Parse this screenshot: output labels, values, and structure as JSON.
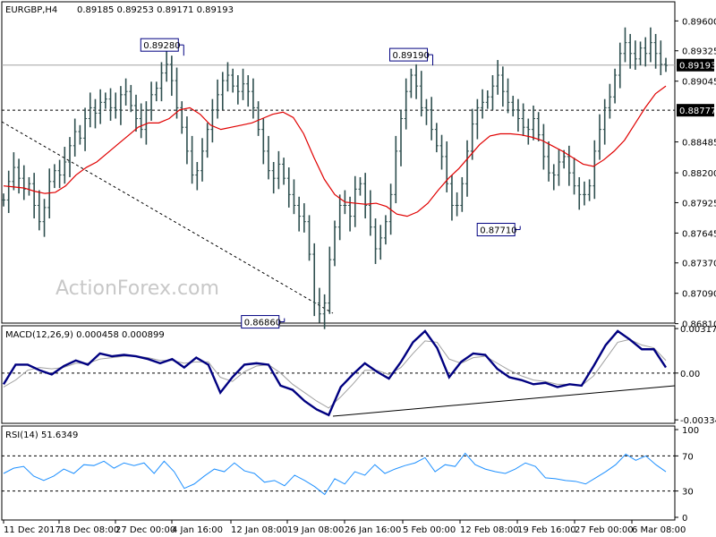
{
  "header": {
    "symbol": "EURGBP,H4",
    "ohlc": "0.89185 0.89253 0.89171 0.89193"
  },
  "watermark": "ActionForex.com",
  "colors": {
    "candles": "#2f4f4f",
    "ma": "#e00000",
    "macd": "#000080",
    "signal": "#a0a0a0",
    "rsi": "#1e90ff",
    "price_tag_bg": "#000000",
    "annotation_border": "#000080"
  },
  "chart_data": [
    {
      "type": "line",
      "title": "EURGBP,H4",
      "ylim": [
        0.8684,
        0.8976
      ],
      "yticks": [
        "0.89600",
        "0.89325",
        "0.89045",
        "0.88485",
        "0.88200",
        "0.87925",
        "0.87645",
        "0.87370",
        "0.87090",
        "0.86810"
      ],
      "xticks": [
        "11 Dec 2017",
        "18 Dec 08:00",
        "27 Dec 00:00",
        "4 Jan 16:00",
        "12 Jan 08:00",
        "19 Jan 08:00",
        "26 Jan 16:00",
        "5 Feb 00:00",
        "12 Feb 08:00",
        "19 Feb 16:00",
        "27 Feb 00:00",
        "6 Mar 08:00"
      ],
      "current_price": "0.89193",
      "horizontal_level": "0.88777",
      "annotations": [
        {
          "text": "0.89280",
          "value": 0.8928
        },
        {
          "text": "0.89190",
          "value": 0.8919
        },
        {
          "text": "0.87710",
          "value": 0.8771
        },
        {
          "text": "0.86860",
          "value": 0.8686
        }
      ],
      "series": [
        {
          "values": [
            0.8795,
            0.8812,
            0.8825,
            0.8815,
            0.8805,
            0.881,
            0.879,
            0.8775,
            0.8788,
            0.8812,
            0.8822,
            0.8818,
            0.883,
            0.8845,
            0.8858,
            0.8852,
            0.887,
            0.888,
            0.8875,
            0.8885,
            0.8888,
            0.888,
            0.8878,
            0.8892,
            0.8895,
            0.8882,
            0.887,
            0.886,
            0.8878,
            0.8892,
            0.8898,
            0.8912,
            0.892,
            0.8905,
            0.888,
            0.8862,
            0.884,
            0.8818,
            0.8822,
            0.884,
            0.886,
            0.8878,
            0.8892,
            0.8905,
            0.891,
            0.89,
            0.8895,
            0.8902,
            0.8895,
            0.888,
            0.886,
            0.884,
            0.8822,
            0.8815,
            0.8828,
            0.8815,
            0.88,
            0.879,
            0.878,
            0.8775,
            0.8745,
            0.87,
            0.869,
            0.87,
            0.874,
            0.877,
            0.879,
            0.879,
            0.878,
            0.8805,
            0.881,
            0.879,
            0.877,
            0.875,
            0.876,
            0.8775,
            0.88,
            0.884,
            0.887,
            0.8895,
            0.891,
            0.89,
            0.888,
            0.8878,
            0.886,
            0.8845,
            0.8835,
            0.881,
            0.879,
            0.879,
            0.881,
            0.884,
            0.8865,
            0.888,
            0.8885,
            0.889,
            0.89,
            0.891,
            0.8895,
            0.8885,
            0.8878,
            0.887,
            0.8862,
            0.886,
            0.887,
            0.8855,
            0.8835,
            0.882,
            0.8818,
            0.883,
            0.8835,
            0.882,
            0.8808,
            0.88,
            0.88,
            0.8808,
            0.884,
            0.886,
            0.888,
            0.889,
            0.891,
            0.893,
            0.894,
            0.893,
            0.8925,
            0.8935,
            0.893,
            0.894,
            0.893,
            0.892,
            0.8919
          ]
        },
        {
          "name": "MA",
          "values": [
            0.8808,
            0.8807,
            0.8806,
            0.8803,
            0.8801,
            0.8802,
            0.8808,
            0.8818,
            0.8825,
            0.883,
            0.8838,
            0.8846,
            0.8854,
            0.8862,
            0.8866,
            0.8866,
            0.887,
            0.8878,
            0.888,
            0.8874,
            0.8864,
            0.886,
            0.8862,
            0.8864,
            0.8866,
            0.887,
            0.8874,
            0.8876,
            0.8871,
            0.8856,
            0.8834,
            0.8814,
            0.88,
            0.8793,
            0.8792,
            0.8791,
            0.8792,
            0.8789,
            0.8782,
            0.878,
            0.8784,
            0.8792,
            0.8804,
            0.8815,
            0.8824,
            0.8835,
            0.8846,
            0.8854,
            0.8856,
            0.8856,
            0.8855,
            0.8853,
            0.885,
            0.8845,
            0.884,
            0.8834,
            0.8828,
            0.8826,
            0.8832,
            0.884,
            0.885,
            0.8865,
            0.888,
            0.8893,
            0.89
          ]
        }
      ]
    },
    {
      "type": "line",
      "title": "MACD(12,26,9) 0.000458 0.000899",
      "ylim": [
        -0.0034,
        0.00325
      ],
      "yticks": [
        "0.003177",
        "0.00",
        "-0.003344"
      ],
      "series": [
        {
          "name": "MACD",
          "values": [
            -0.0008,
            0.0006,
            0.0006,
            0.0002,
            -0.0001,
            0.0005,
            0.0009,
            0.0006,
            0.0014,
            0.0012,
            0.0013,
            0.0012,
            0.001,
            0.0007,
            0.001,
            0.0004,
            0.0011,
            0.0006,
            -0.0014,
            -0.0003,
            0.0006,
            0.0007,
            0.0006,
            -0.0009,
            -0.0012,
            -0.002,
            -0.0026,
            -0.003,
            -0.001,
            -0.0001,
            0.0007,
            0.0001,
            -0.0004,
            0.0008,
            0.0022,
            0.003,
            0.0018,
            -0.0003,
            0.0008,
            0.0014,
            0.0013,
            0.0003,
            -0.0003,
            -0.0005,
            -0.0008,
            -0.0007,
            -0.001,
            -0.0008,
            -0.0009,
            0.0005,
            0.002,
            0.003,
            0.0024,
            0.0017,
            0.0017,
            0.0004
          ]
        },
        {
          "name": "Signal",
          "values": [
            -0.001,
            -0.0005,
            0.0002,
            0.0004,
            0.0003,
            0.0004,
            0.0007,
            0.0007,
            0.001,
            0.0011,
            0.0012,
            0.0012,
            0.0011,
            0.0009,
            0.0009,
            0.0007,
            0.0008,
            0.0008,
            -0.0003,
            -0.0006,
            0.0001,
            0.0005,
            0.0006,
            0.0,
            -0.0008,
            -0.0014,
            -0.002,
            -0.0025,
            -0.0017,
            -0.0008,
            0.0002,
            0.0002,
            -0.0001,
            0.0004,
            0.0014,
            0.0023,
            0.0022,
            0.001,
            0.0007,
            0.0011,
            0.0012,
            0.0007,
            0.0002,
            -0.0002,
            -0.0005,
            -0.0006,
            -0.0008,
            -0.0008,
            -0.0009,
            -0.0002,
            0.001,
            0.0022,
            0.0024,
            0.002,
            0.0018,
            0.0009
          ]
        }
      ]
    },
    {
      "type": "line",
      "title": "RSI(14) 51.6349",
      "ylim": [
        0,
        100
      ],
      "yticks": [
        "100",
        "70",
        "30",
        "0"
      ],
      "levels": [
        70,
        30
      ],
      "series": [
        {
          "name": "RSI",
          "values": [
            50,
            56,
            58,
            47,
            42,
            47,
            55,
            50,
            60,
            59,
            64,
            56,
            62,
            59,
            62,
            50,
            64,
            52,
            33,
            38,
            47,
            55,
            52,
            62,
            53,
            50,
            40,
            42,
            36,
            48,
            42,
            35,
            26,
            44,
            38,
            52,
            48,
            60,
            50,
            55,
            59,
            62,
            68,
            52,
            60,
            58,
            73,
            60,
            55,
            52,
            50,
            55,
            62,
            58,
            45,
            44,
            42,
            41,
            38,
            45,
            52,
            60,
            72,
            65,
            70,
            60,
            52
          ]
        }
      ]
    }
  ]
}
